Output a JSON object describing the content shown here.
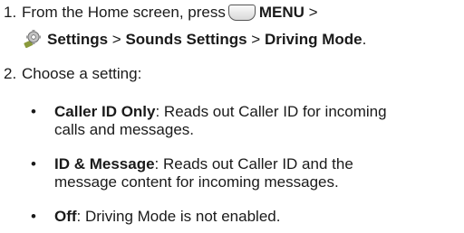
{
  "steps": [
    {
      "number": "1.",
      "prefix": "From the Home screen, press",
      "menu_label": "MENU",
      "sep1": " >",
      "settings_label": "Settings",
      "sep2": " > ",
      "sounds_label": "Sounds Settings",
      "sep3": " > ",
      "driving_label": "Driving Mode",
      "end": "."
    },
    {
      "number": "2.",
      "text": "Choose a setting:"
    }
  ],
  "bullet_glyph": "•",
  "options": [
    {
      "name": "Caller ID Only",
      "desc_line1": ": Reads out Caller ID for incoming",
      "desc_line2": "calls and messages."
    },
    {
      "name": "ID & Message",
      "desc_line1": ": Reads out Caller ID and the",
      "desc_line2": "message content for incoming messages."
    },
    {
      "name": "Off",
      "desc_line1": ": Driving Mode is not enabled.",
      "desc_line2": ""
    }
  ],
  "icons": {
    "menu_key": "menu-key-icon",
    "settings": "settings-gear-icon"
  }
}
